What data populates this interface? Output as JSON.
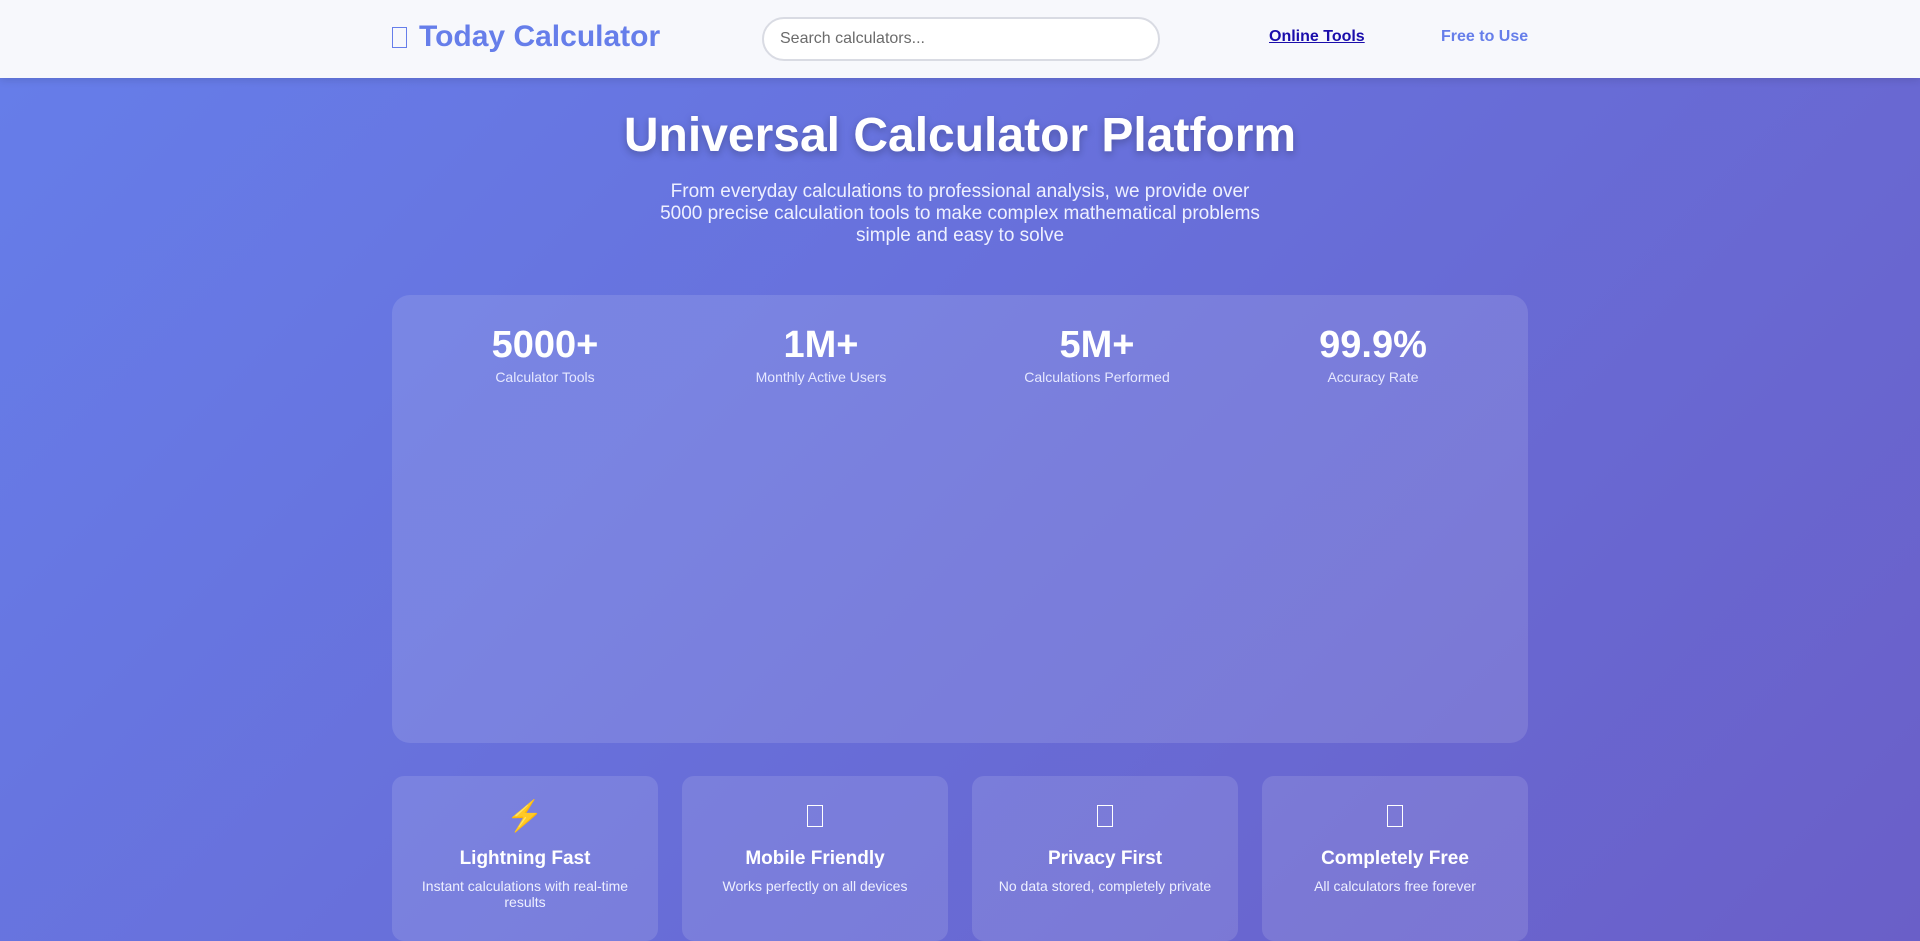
{
  "header": {
    "logo_text": "Today Calculator",
    "search_placeholder": "Search calculators...",
    "nav": {
      "online_tools": "Online Tools",
      "free_to_use": "Free to Use"
    }
  },
  "hero": {
    "title": "Universal Calculator Platform",
    "subtitle": "From everyday calculations to professional analysis, we provide over 5000 precise calculation tools to make complex mathematical problems simple and easy to solve"
  },
  "stats": [
    {
      "value": "5000+",
      "label": "Calculator Tools"
    },
    {
      "value": "1M+",
      "label": "Monthly Active Users"
    },
    {
      "value": "5M+",
      "label": "Calculations Performed"
    },
    {
      "value": "99.9%",
      "label": "Accuracy Rate"
    }
  ],
  "features": [
    {
      "icon": "lightning-icon",
      "glyph": "⚡",
      "title": "Lightning Fast",
      "desc": "Instant calculations with real-time results"
    },
    {
      "icon": "mobile-icon",
      "title": "Mobile Friendly",
      "desc": "Works perfectly on all devices"
    },
    {
      "icon": "lock-icon",
      "title": "Privacy First",
      "desc": "No data stored, completely private"
    },
    {
      "icon": "gift-icon",
      "title": "Completely Free",
      "desc": "All calculators free forever"
    }
  ],
  "colors": {
    "accent": "#667eea",
    "gradient_end": "#6a5fc8",
    "nav_link": "#1a0dab"
  }
}
